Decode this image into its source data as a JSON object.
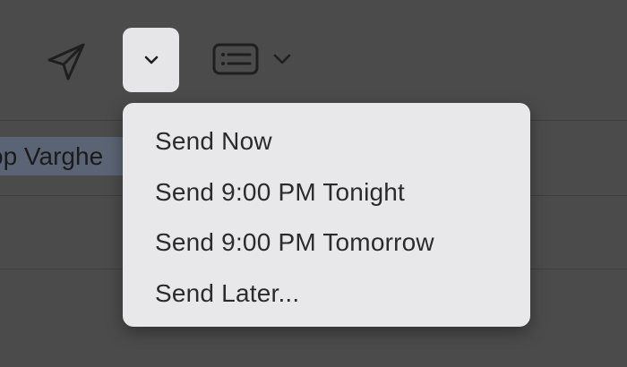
{
  "toolbar": {
    "send_icon": "paper-plane-icon",
    "send_options_icon": "chevron-down-icon",
    "format_icon": "message-format-icon",
    "format_chevron_icon": "chevron-down-icon"
  },
  "compose": {
    "recipient_visible_text": "op Varghe"
  },
  "send_menu": {
    "items": [
      {
        "label": "Send Now"
      },
      {
        "label": "Send 9:00 PM Tonight"
      },
      {
        "label": "Send 9:00 PM Tomorrow"
      },
      {
        "label": "Send Later..."
      }
    ]
  },
  "colors": {
    "window_background": "#4b4b4b",
    "menu_background": "#e8e8ea",
    "menu_text": "#2b2b2b",
    "selected_button_background": "#e6e6e8",
    "recipient_token_background": "#5b6474",
    "icon_stroke": "#1f1f1f"
  }
}
